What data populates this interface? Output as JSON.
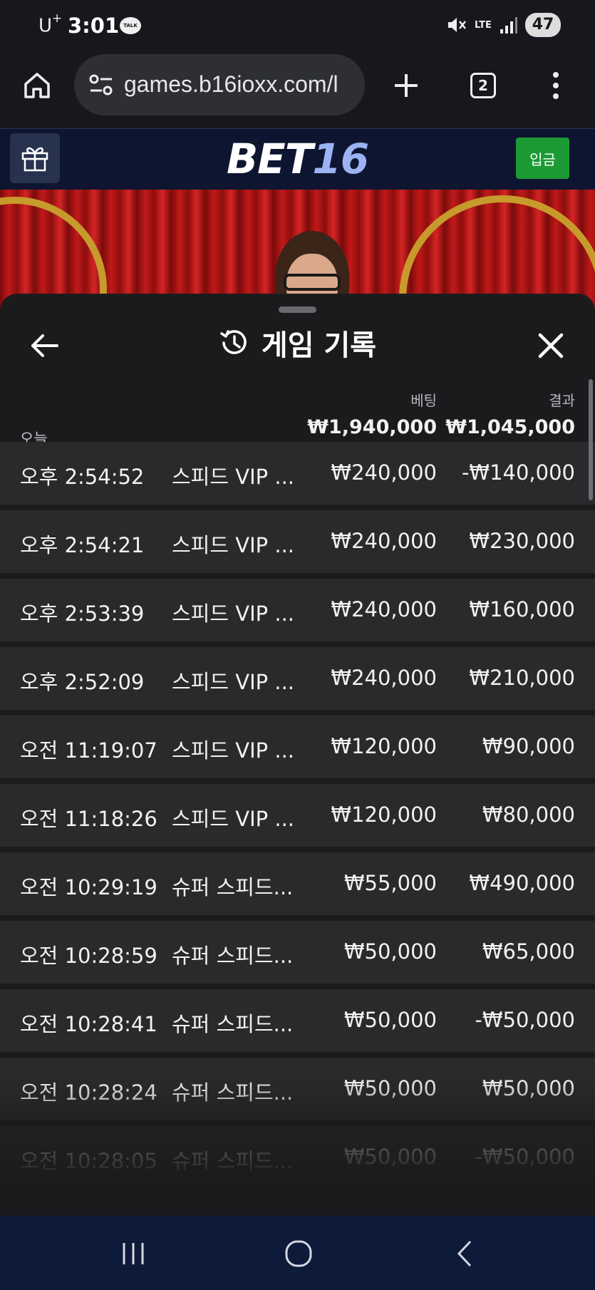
{
  "status_bar": {
    "carrier": "U",
    "carrier_sup": "+",
    "time": "3:01",
    "talk_badge": "TALK",
    "network": "LTE",
    "battery": "47"
  },
  "browser": {
    "url": "games.b16ioxx.com/l",
    "tab_count": "2"
  },
  "site": {
    "logo_bet": "BET",
    "logo_num": "16",
    "deposit_label": "입금"
  },
  "panel": {
    "title": "게임 기록",
    "col_bet": "베팅",
    "col_result": "결과",
    "today_label": "오늘",
    "total_bet": "₩1,940,000",
    "total_result": "₩1,045,000",
    "rows": [
      {
        "time": "오후 2:54:52",
        "game": "스피드 VIP ...",
        "bet": "₩240,000",
        "result": "-₩140,000"
      },
      {
        "time": "오후 2:54:21",
        "game": "스피드 VIP ...",
        "bet": "₩240,000",
        "result": "₩230,000"
      },
      {
        "time": "오후 2:53:39",
        "game": "스피드 VIP ...",
        "bet": "₩240,000",
        "result": "₩160,000"
      },
      {
        "time": "오후 2:52:09",
        "game": "스피드 VIP ...",
        "bet": "₩240,000",
        "result": "₩210,000"
      },
      {
        "time": "오전 11:19:07",
        "game": "스피드 VIP ...",
        "bet": "₩120,000",
        "result": "₩90,000"
      },
      {
        "time": "오전 11:18:26",
        "game": "스피드 VIP ...",
        "bet": "₩120,000",
        "result": "₩80,000"
      },
      {
        "time": "오전 10:29:19",
        "game": "슈퍼 스피드...",
        "bet": "₩55,000",
        "result": "₩490,000"
      },
      {
        "time": "오전 10:28:59",
        "game": "슈퍼 스피드...",
        "bet": "₩50,000",
        "result": "₩65,000"
      },
      {
        "time": "오전 10:28:41",
        "game": "슈퍼 스피드...",
        "bet": "₩50,000",
        "result": "-₩50,000"
      },
      {
        "time": "오전 10:28:24",
        "game": "슈퍼 스피드...",
        "bet": "₩50,000",
        "result": "₩50,000"
      },
      {
        "time": "오전 10:28:05",
        "game": "슈퍼 스피드...",
        "bet": "₩50,000",
        "result": "-₩50,000"
      }
    ]
  },
  "icons": {
    "home": "home-icon",
    "site_settings": "tune-icon",
    "new_tab": "plus-icon",
    "menu": "more-vert-icon",
    "gift": "gift-icon",
    "back": "arrow-left-icon",
    "history": "history-icon",
    "close": "close-icon",
    "nav_recents": "recents-icon",
    "nav_home": "home-circle-icon",
    "nav_back": "back-chevron-icon"
  },
  "colors": {
    "header_bg": "#0d1530",
    "deposit_green": "#1c9b34",
    "logo_accent": "#9bb3f2",
    "panel_bg": "#1b1b1d",
    "row_bg": "#2a2a2c"
  }
}
